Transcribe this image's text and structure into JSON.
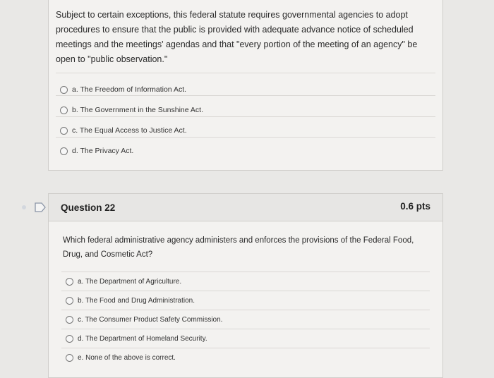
{
  "question_prev": {
    "prompt": "Subject to certain exceptions, this federal statute requires governmental agencies to adopt procedures to ensure that the public is provided with adequate advance notice of scheduled meetings and the meetings' agendas and that \"every portion of the meeting of an agency\" be open to \"public observation.\"",
    "answers": [
      "a. The Freedom of Information Act.",
      "b. The Government in the Sunshine Act.",
      "c. The Equal Access to Justice Act.",
      "d. The Privacy Act."
    ]
  },
  "question_22": {
    "title": "Question 22",
    "points": "0.6 pts",
    "prompt": "Which federal administrative agency administers and enforces the provisions of the Federal Food, Drug, and Cosmetic Act?",
    "answers": [
      "a. The Department of Agriculture.",
      "b. The Food and Drug Administration.",
      "c. The Consumer Product Safety Commission.",
      "d. The Department of Homeland Security.",
      "e. None of the above is correct."
    ]
  },
  "icons": {
    "flag": "flag-question-icon"
  }
}
